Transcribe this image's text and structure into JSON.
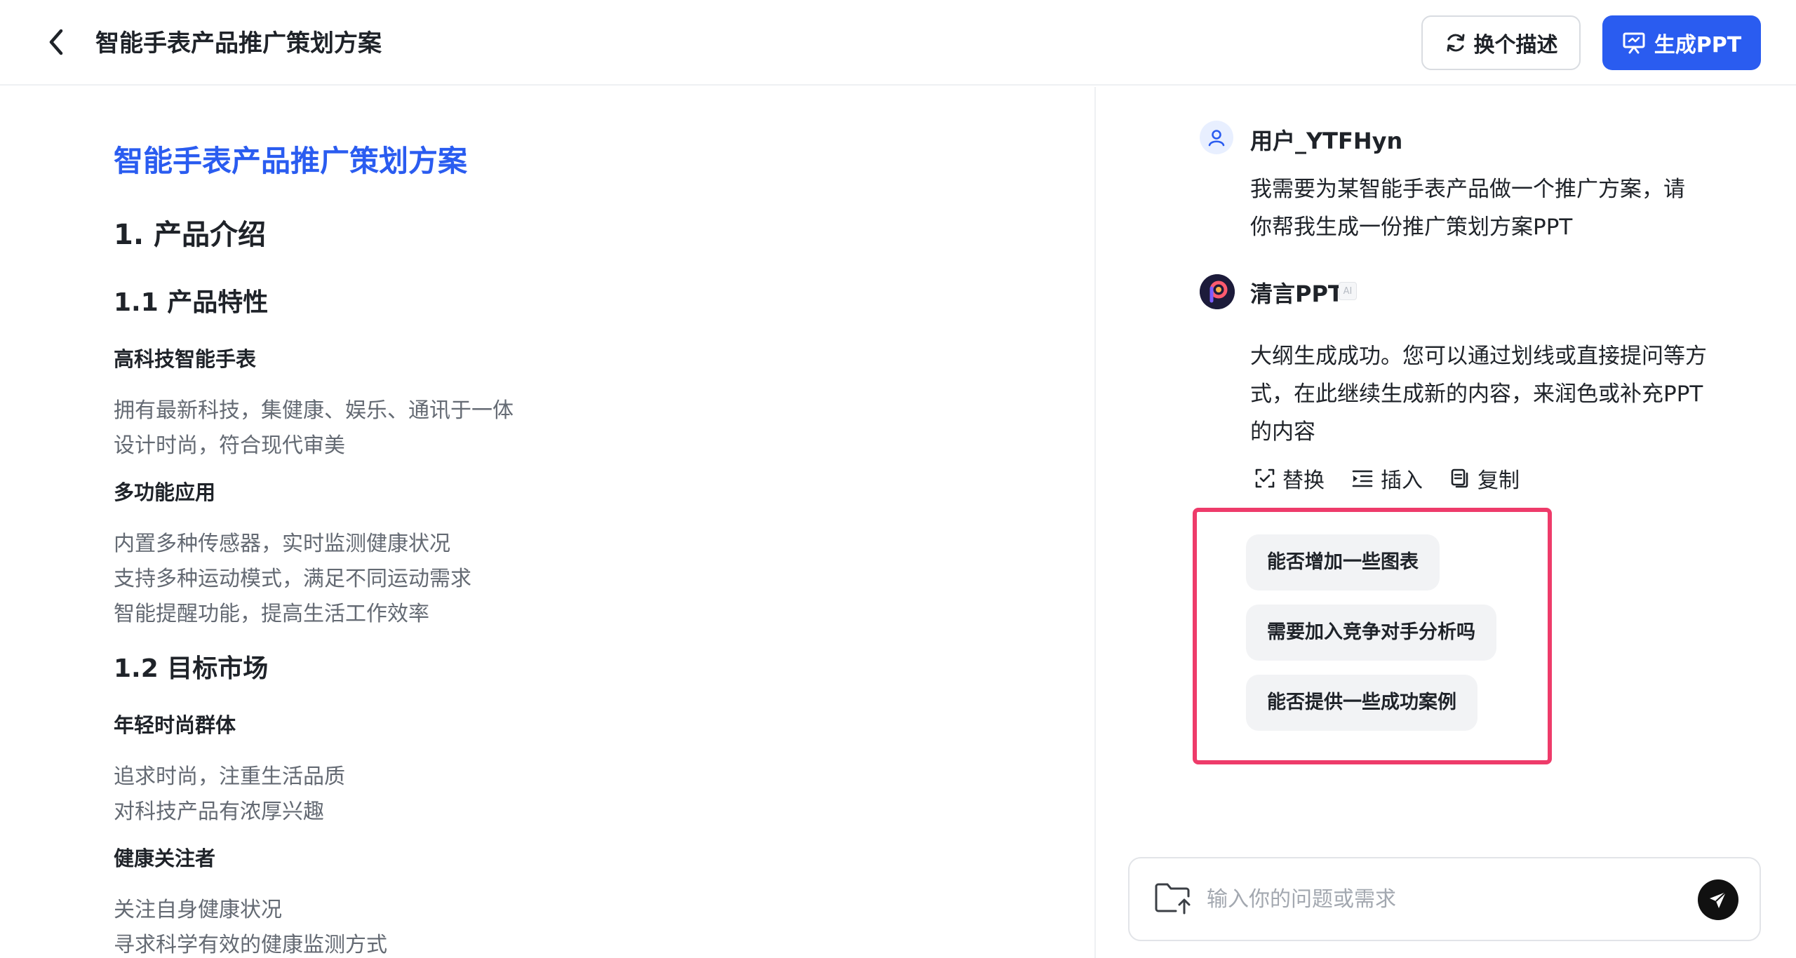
{
  "header": {
    "title": "智能手表产品推广策划方案",
    "rewrite_label": "换个描述",
    "generate_label": "生成PPT"
  },
  "doc": {
    "title": "智能手表产品推广策划方案",
    "sections": [
      {
        "heading": "1. 产品介绍",
        "subsections": [
          {
            "heading": "1.1 产品特性",
            "groups": [
              {
                "title": "高科技智能手表",
                "lines": [
                  "拥有最新科技，集健康、娱乐、通讯于一体",
                  "设计时尚，符合现代审美"
                ]
              },
              {
                "title": "多功能应用",
                "lines": [
                  "内置多种传感器，实时监测健康状况",
                  "支持多种运动模式，满足不同运动需求",
                  "智能提醒功能，提高生活工作效率"
                ]
              }
            ]
          },
          {
            "heading": "1.2 目标市场",
            "groups": [
              {
                "title": "年轻时尚群体",
                "lines": [
                  "追求时尚，注重生活品质",
                  "对科技产品有浓厚兴趣"
                ]
              },
              {
                "title": "健康关注者",
                "lines": [
                  "关注自身健康状况",
                  "寻求科学有效的健康监测方式"
                ]
              }
            ]
          }
        ]
      }
    ]
  },
  "chat": {
    "user": {
      "name": "用户_YTFHyn",
      "message_lines": [
        "我需要为某智能手表产品做一个推广方案，请",
        "你帮我生成一份推广策划方案PPT"
      ]
    },
    "bot": {
      "name": "清言PPT",
      "badge": "AI",
      "message_lines": [
        "大纲生成成功。您可以通过划线或直接提问等方",
        "式，在此继续生成新的内容，来润色或补充PPT",
        "的内容"
      ],
      "actions": [
        {
          "label": "替换",
          "icon": "replace-icon"
        },
        {
          "label": "插入",
          "icon": "insert-icon"
        },
        {
          "label": "复制",
          "icon": "copy-icon"
        }
      ]
    },
    "suggestions": [
      "能否增加一些图表",
      "需要加入竞争对手分析吗",
      "能否提供一些成功案例"
    ],
    "input": {
      "placeholder": "输入你的问题或需求",
      "value": ""
    }
  },
  "colors": {
    "accent": "#2a5cf0",
    "highlight_border": "#ee3b6a",
    "chip_bg": "#f2f3f5",
    "muted_text": "#646a73"
  }
}
